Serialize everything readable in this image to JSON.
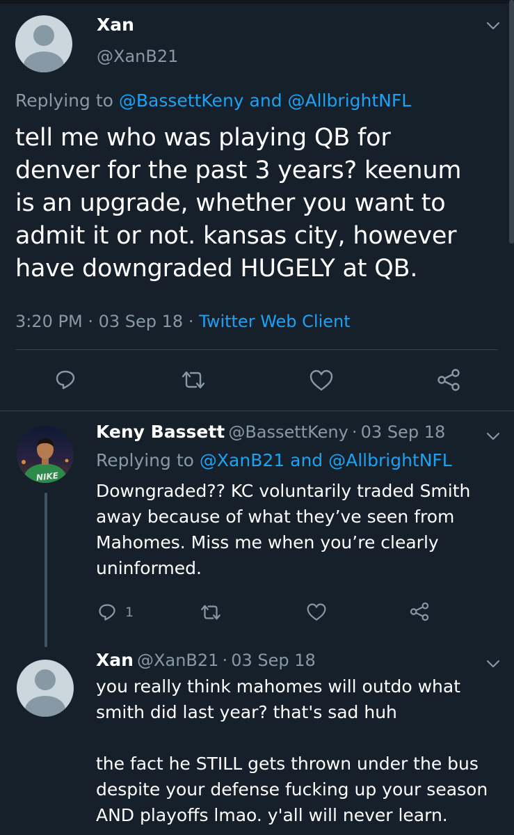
{
  "main_tweet": {
    "name": "Xan",
    "handle": "@XanB21",
    "replying_prefix": "Replying to",
    "replying_user1": "@BassettKeny",
    "replying_and": "and",
    "replying_user2": "@AllbrightNFL",
    "text_lines": [
      "tell me who was playing QB for",
      "denver for the past 3 years? keenum",
      "is an upgrade, whether you want to",
      "admit it or not. kansas city, however",
      "have downgraded HUGELY at QB."
    ],
    "time": "3:20 PM",
    "date": "03 Sep 18",
    "client": "Twitter Web Client"
  },
  "reply1": {
    "name": "Keny Bassett",
    "handle": "@BassettKeny",
    "date": "03 Sep 18",
    "replying_prefix": "Replying to",
    "replying_user1": "@XanB21",
    "replying_and": "and",
    "replying_user2": "@AllbrightNFL",
    "text_lines": [
      "Downgraded?? KC voluntarily traded Smith",
      "away because of what they’ve seen from",
      "Mahomes. Miss me when you’re clearly",
      "uninformed."
    ],
    "reply_count": "1",
    "shirt_text": "NIKE"
  },
  "reply2": {
    "name": "Xan",
    "handle": "@XanB21",
    "date": "03 Sep 18",
    "text_lines": [
      "you really think mahomes will outdo what",
      "smith did last year? that's sad huh",
      "",
      "the fact he STILL gets thrown under the bus",
      "despite your defense fucking up your season",
      "AND playoffs lmao. y'all will never learn."
    ]
  },
  "separator": "·",
  "icons": {
    "reply": "reply-icon",
    "retweet": "retweet-icon",
    "like": "heart-icon",
    "share": "share-icon",
    "more": "chevron-down-icon"
  },
  "colors": {
    "background": "#15202b",
    "link": "#1da1f2",
    "muted": "#8899a6",
    "divider": "#38444d"
  }
}
